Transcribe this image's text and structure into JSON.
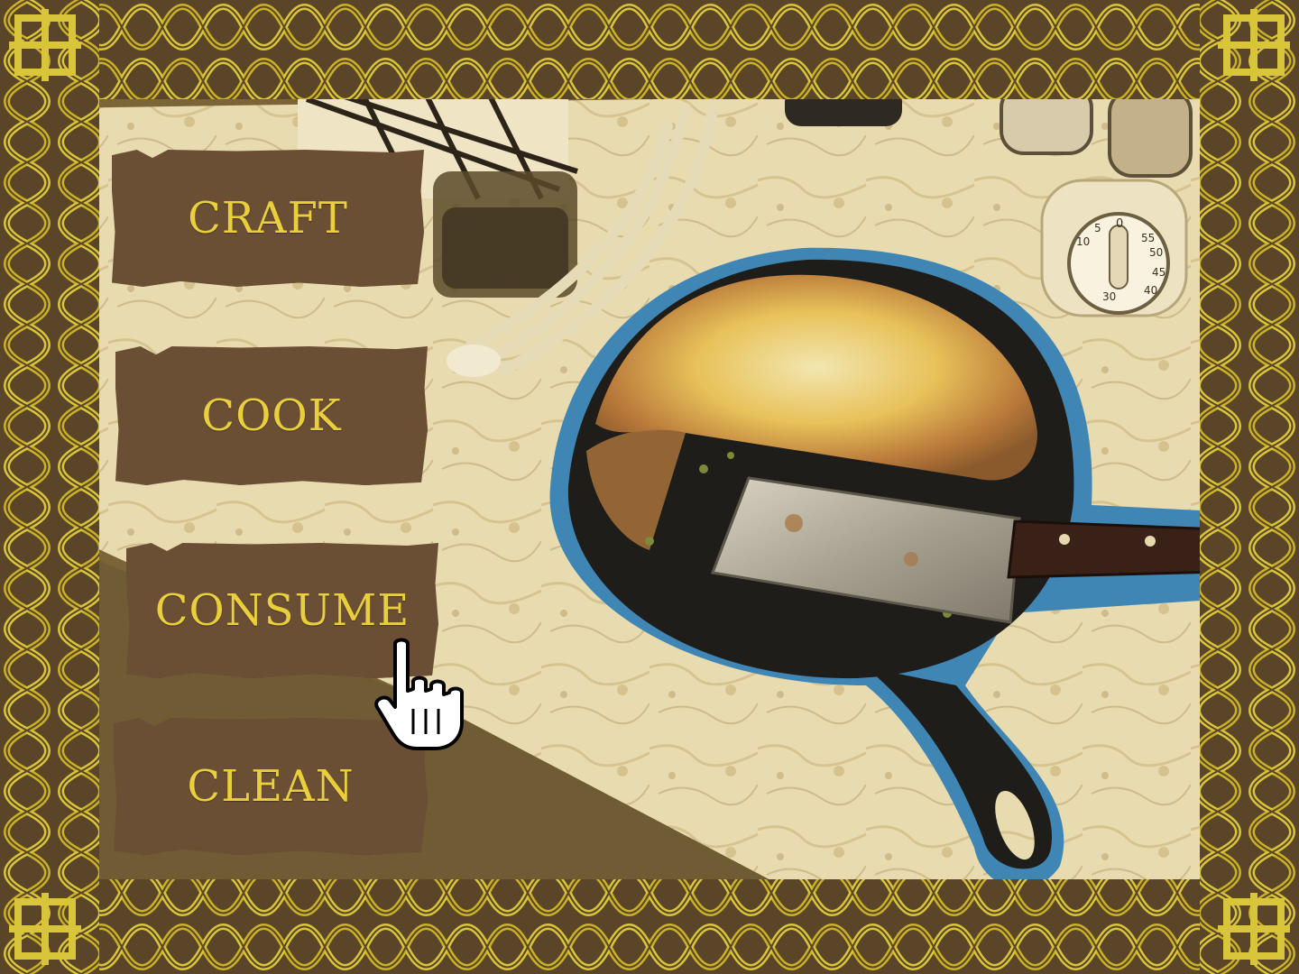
{
  "menu": {
    "items": [
      {
        "label": "CRAFT"
      },
      {
        "label": "COOK"
      },
      {
        "label": "CONSUME"
      },
      {
        "label": "CLEAN"
      }
    ],
    "hovered": "CONSUME"
  },
  "timer": {
    "dial_numbers": [
      "0",
      "5",
      "10",
      "50",
      "55",
      "45",
      "40",
      "30"
    ]
  },
  "colors": {
    "button_fill": "#6b4f35",
    "button_text": "#e8cf3b",
    "border_gold": "#c9b227",
    "border_dark": "#5a4528",
    "pan_outline": "#3f86b5",
    "marble": "#e9dbb0"
  },
  "icons": {
    "cursor": "hand-pointer-icon",
    "border": "celtic-knot-border"
  }
}
